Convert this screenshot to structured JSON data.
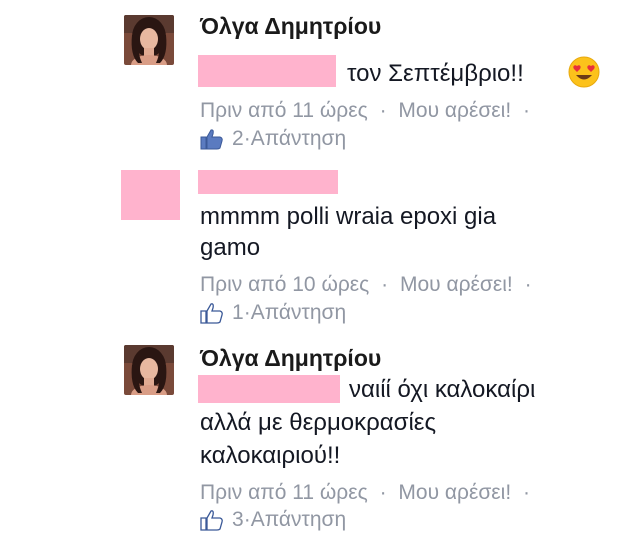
{
  "comments": [
    {
      "author": "Όλγα Δημητρίου",
      "text": "τον Σεπτέμβριο!!",
      "time": "Πριν από 11 ώρες",
      "like_action": "Μου αρέσει!",
      "like_count": "2",
      "reply_action": "Απάντηση",
      "emoji": "heart-eyes-emoji"
    },
    {
      "text_line1": "mmmm polli wraia epoxi gia",
      "text_line2": "gamo",
      "time": "Πριν από 10 ώρες",
      "like_action": "Μου αρέσει!",
      "like_count": "1",
      "reply_action": "Απάντηση"
    },
    {
      "author": "Όλγα Δημητρίου",
      "text_line1": "ναιίί όχι καλοκαίρι",
      "text_line2": "αλλά με θερμοκρασίες",
      "text_line3": "καλοκαιριού!!",
      "time": "Πριν από 11 ώρες",
      "like_action": "Μου αρέσει!",
      "like_count": "3",
      "reply_action": "Απάντηση"
    }
  ],
  "separator": "·",
  "colors": {
    "redaction": "#ffb3cd",
    "meta": "#9197a3",
    "text": "#141823"
  }
}
